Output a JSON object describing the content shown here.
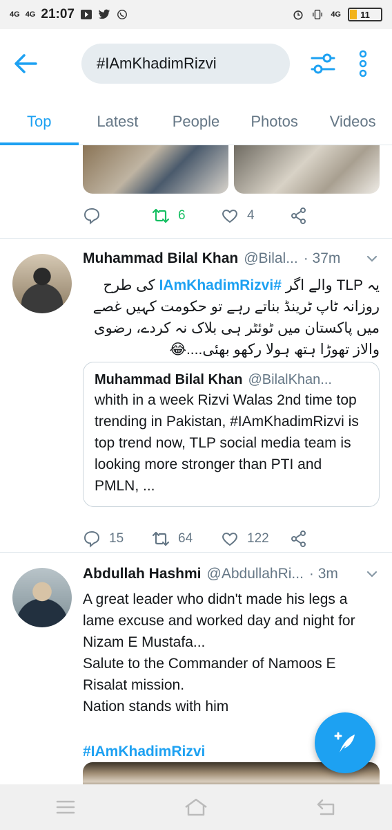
{
  "status_bar": {
    "net1": "4G",
    "net2": "4G",
    "time": "21:07",
    "net3": "4G",
    "battery": "11"
  },
  "search": {
    "query": "#IAmKhadimRizvi"
  },
  "tabs": [
    {
      "label": "Top",
      "active": true
    },
    {
      "label": "Latest"
    },
    {
      "label": "People"
    },
    {
      "label": "Photos"
    },
    {
      "label": "Videos"
    }
  ],
  "tweet0": {
    "replies": "",
    "retweets": "6",
    "likes": "4"
  },
  "tweet1": {
    "name": "Muhammad Bilal Khan",
    "handle": "@Bilal...",
    "time": "· 37m",
    "text_line1_a": "یہ TLP والے اگر ",
    "hashtag": "#IAmKhadimRizvi",
    "text_line1_b": " کی طرح",
    "text_rest": "روزانہ ٹاپ ٹرینڈ بناتے رہے تو حکومت کہیں غصے میں پاکستان میں ٹوئٹر ہی بلاک نہ کردے، رضوی والاز تھوڑا ہتھ ہولا رکھو بھئی....😂",
    "quote": {
      "name": "Muhammad Bilal Khan",
      "handle": "@BilalKhan...",
      "text": "whith in a week Rizvi Walas 2nd time top trending in Pakistan, #IAmKhadimRizvi is top trend now, TLP social media team is looking more stronger than PTI and PMLN, ..."
    },
    "replies": "15",
    "retweets": "64",
    "likes": "122"
  },
  "tweet2": {
    "name": "Abdullah Hashmi",
    "handle": "@AbdullahRi...",
    "time": "· 3m",
    "text": "A great leader who didn't made his legs a lame excuse and worked day and night for Nizam E Mustafa...\nSalute to the Commander of Namoos E Risalat mission.\nNation stands with him",
    "hashtag": "#IAmKhadimRizvi"
  },
  "colors": {
    "accent": "#1da1f2",
    "retweet_active": "#17bf63",
    "muted": "#657786"
  }
}
